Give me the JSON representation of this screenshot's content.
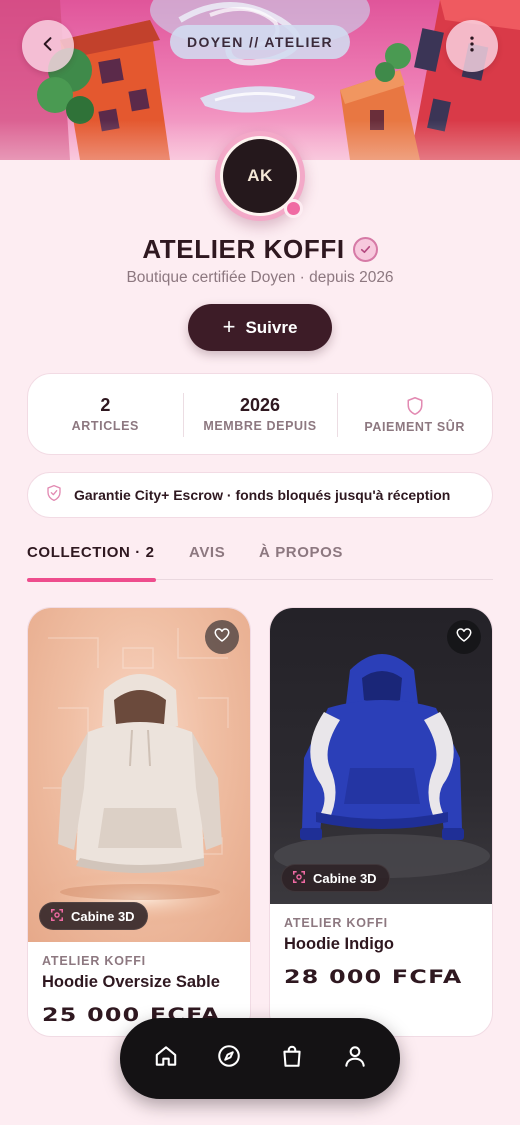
{
  "header": {
    "title": "DOYEN // ATELIER",
    "back_icon": "chevron-left-icon",
    "more_icon": "more-vertical-icon"
  },
  "store": {
    "initials": "AK",
    "name": "ATELIER KOFFI",
    "subtitle": "Boutique certifiée Doyen · depuis 2026",
    "follow_label": "Suivre",
    "follow_icon": "plus",
    "verified_icon": "check-badge-icon"
  },
  "stats": [
    {
      "value": "2",
      "label": "ARTICLES"
    },
    {
      "value": "2026",
      "label": "MEMBRE DEPUIS"
    },
    {
      "icon": "shield-icon",
      "label": "PAIEMENT SÛR"
    }
  ],
  "escrow": {
    "icon": "shield-check-icon",
    "text": "Garantie City+ Escrow · fonds bloqués jusqu'à réception"
  },
  "tabs": [
    {
      "label": "COLLECTION · 2",
      "active": true
    },
    {
      "label": "AVIS",
      "active": false
    },
    {
      "label": "À PROPOS",
      "active": false
    }
  ],
  "products": [
    {
      "shop": "ATELIER KOFFI",
      "name": "Hoodie Oversize Sable",
      "price": "25 000 FCFA",
      "badge": "Cabine 3D",
      "color": "#ece3dc"
    },
    {
      "shop": "ATELIER KOFFI",
      "name": "Hoodie Indigo",
      "price": "28 000 FCFA",
      "badge": "Cabine 3D",
      "color": "#2b3fb8"
    }
  ],
  "colors": {
    "accent": "#ee4d8d",
    "dark": "#3d1c27",
    "background": "#fdedf2",
    "muted": "#8d7880"
  },
  "nav": [
    {
      "icon": "home-icon"
    },
    {
      "icon": "compass-icon"
    },
    {
      "icon": "shopping-bag-icon"
    },
    {
      "icon": "user-icon"
    }
  ]
}
